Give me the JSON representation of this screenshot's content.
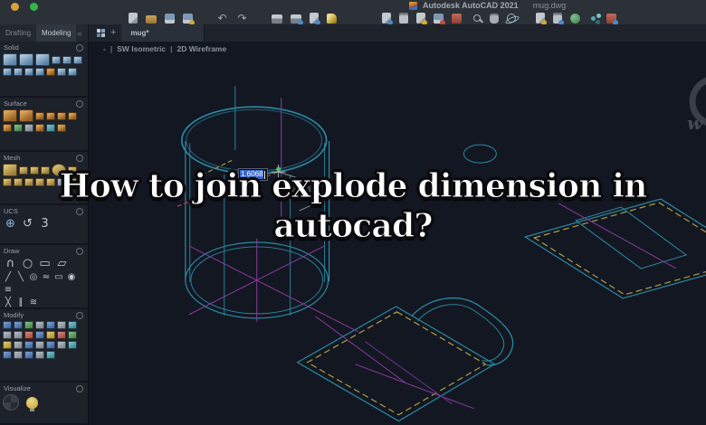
{
  "window": {
    "app_title": "Autodesk AutoCAD 2021",
    "doc_title": "mug.dwg",
    "traffic_lights": [
      "#d9a13c",
      "#34b54a"
    ]
  },
  "toolbar": {
    "groups": [
      [
        {
          "n": "new-file-icon",
          "c": "ic-doc"
        },
        {
          "n": "open-folder-icon",
          "c": "ic-folder"
        },
        {
          "n": "save-icon",
          "c": "ic-save"
        },
        {
          "n": "save-as-icon",
          "c": "ic-save acc-yellow"
        }
      ],
      [
        {
          "n": "undo-icon",
          "c": "ic-glyph",
          "g": "↶"
        },
        {
          "n": "redo-icon",
          "c": "ic-glyph",
          "g": "↷"
        }
      ],
      [
        {
          "n": "print-icon",
          "c": "ic-printer"
        },
        {
          "n": "print-preview-icon",
          "c": "ic-printer acc-blue"
        },
        {
          "n": "publish-icon",
          "c": "ic-doc acc-blue"
        },
        {
          "n": "page-setup-icon",
          "c": "ic-pencil"
        }
      ],
      [
        {
          "n": "copy-doc-icon",
          "c": "ic-doc acc-blue"
        },
        {
          "n": "paste-clipboard-icon",
          "c": "ic-clip"
        },
        {
          "n": "match-properties-icon",
          "c": "ic-doc acc-yellow"
        },
        {
          "n": "block-icon",
          "c": "ic-save acc-red"
        },
        {
          "n": "xref-book-icon",
          "c": "ic-book"
        }
      ],
      [
        {
          "n": "zoom-icon",
          "c": "ic-mag"
        },
        {
          "n": "pan-hand-icon",
          "c": "ic-hand"
        },
        {
          "n": "orbit-icon",
          "c": "ic-orbit"
        }
      ],
      [
        {
          "n": "markup-doc-icon",
          "c": "ic-doc acc-yellow"
        },
        {
          "n": "clipboard-chart-icon",
          "c": "ic-clip acc-blue"
        },
        {
          "n": "geolocation-globe-icon",
          "c": "ic-globe"
        },
        {
          "n": "nodes-icon",
          "c": "ic-node"
        },
        {
          "n": "reference-doc-icon",
          "c": "ic-book acc-blue"
        }
      ]
    ]
  },
  "palette": {
    "tabs": [
      {
        "label": "Drafting",
        "active": false
      },
      {
        "label": "Modeling",
        "active": true
      }
    ],
    "collapse": "«",
    "sections": [
      {
        "label": "Solid",
        "rows": [
          [
            {
              "n": "box-icon",
              "c": "tb f-solid"
            },
            {
              "n": "wedge-icon",
              "c": "tb f-solid"
            },
            {
              "n": "union-icon",
              "c": "tb f-solid"
            },
            {
              "n": "cylinder-icon",
              "c": "ts f-solid"
            },
            {
              "n": "sphere-icon",
              "c": "ts f-solid"
            },
            {
              "n": "cone-icon",
              "c": "ts f-solid"
            }
          ],
          [
            {
              "n": "extrude-icon",
              "c": "ts f-solid"
            },
            {
              "n": "revolve-icon",
              "c": "ts f-solid"
            },
            {
              "n": "sweep-icon",
              "c": "ts f-solid"
            },
            {
              "n": "loft-icon",
              "c": "ts f-solid"
            },
            {
              "n": "presspull-icon",
              "c": "ts f-surface"
            },
            {
              "n": "slice-icon",
              "c": "ts f-solid"
            },
            {
              "n": "shell-icon",
              "c": "ts f-solid"
            }
          ]
        ]
      },
      {
        "label": "Surface",
        "rows": [
          [
            {
              "n": "network-surface-icon",
              "c": "tb f-surface"
            },
            {
              "n": "loft-surface-icon",
              "c": "tb f-surface"
            },
            {
              "n": "blend-surface-icon",
              "c": "ts f-surface"
            },
            {
              "n": "patch-surface-icon",
              "c": "ts f-surface"
            },
            {
              "n": "offset-surface-icon",
              "c": "ts f-surface"
            },
            {
              "n": "fillet-surface-icon",
              "c": "ts f-surface"
            }
          ],
          [
            {
              "n": "trim-surface-icon",
              "c": "ts f-surface"
            },
            {
              "n": "untrim-surface-icon",
              "c": "ts f-green"
            },
            {
              "n": "extend-surface-icon",
              "c": "ts f-gray"
            },
            {
              "n": "sculpt-icon",
              "c": "ts f-surface"
            },
            {
              "n": "convert-surface-icon",
              "c": "ts f-teal"
            },
            {
              "n": "thicken-icon",
              "c": "ts f-surface"
            }
          ]
        ]
      },
      {
        "label": "Mesh",
        "rows": [
          [
            {
              "n": "mesh-box-icon",
              "c": "tb f-mesh"
            },
            {
              "n": "smooth-object-icon",
              "c": "ts f-mesh"
            },
            {
              "n": "refine-mesh-icon",
              "c": "ts f-mesh"
            },
            {
              "n": "add-crease-icon",
              "c": "ts f-mesh"
            },
            {
              "n": "mesh-sphere-icon",
              "c": "tb f-mesh round"
            },
            {
              "n": "split-face-icon",
              "c": "ts f-mesh"
            }
          ],
          [
            {
              "n": "mesh-cone-icon",
              "c": "ts f-mesh"
            },
            {
              "n": "mesh-cylinder-icon",
              "c": "ts f-mesh"
            },
            {
              "n": "mesh-pyramid-icon",
              "c": "ts f-mesh"
            },
            {
              "n": "mesh-wedge-icon",
              "c": "ts f-mesh"
            },
            {
              "n": "mesh-torus-icon",
              "c": "ts f-mesh"
            },
            {
              "n": "extrude-face-icon",
              "c": "ts f-gray"
            },
            {
              "n": "merge-face-icon",
              "c": "ts f-mesh"
            }
          ]
        ]
      },
      {
        "label": "UCS",
        "rows": [
          [
            {
              "n": "ucs-world-icon",
              "c": "g-draw g-big ucsw",
              "g": "⊕"
            },
            {
              "n": "ucs-rotate-z-icon",
              "c": "g-draw g-big",
              "g": "↺"
            },
            {
              "n": "ucs-3point-icon",
              "c": "g-draw g-big",
              "g": "3"
            }
          ]
        ]
      },
      {
        "label": "Draw",
        "rows": [
          [
            {
              "n": "arc-icon",
              "c": "g-draw g-big",
              "g": "∩"
            },
            {
              "n": "circle-icon",
              "c": "g-draw g-big",
              "g": "○"
            },
            {
              "n": "rectangle-icon",
              "c": "g-draw g-big",
              "g": "▭"
            },
            {
              "n": "plane-surface-icon",
              "c": "g-draw g-big",
              "g": "▱"
            }
          ],
          [
            {
              "n": "sketch-icon",
              "c": "g-draw",
              "g": "╱"
            },
            {
              "n": "line-icon",
              "c": "g-draw",
              "g": "╲"
            },
            {
              "n": "ellipse-icon",
              "c": "g-draw",
              "g": "◎"
            },
            {
              "n": "spline-icon",
              "c": "g-draw",
              "g": "≈"
            },
            {
              "n": "rectangle-small-icon",
              "c": "g-draw",
              "g": "▭"
            },
            {
              "n": "donut-icon",
              "c": "g-draw",
              "g": "◉"
            },
            {
              "n": "hatch-icon",
              "c": "g-draw",
              "g": "≡"
            }
          ],
          [
            {
              "n": "divide-icon",
              "c": "g-draw",
              "g": "╳"
            },
            {
              "n": "offset-lines-icon",
              "c": "g-draw",
              "g": "∥"
            },
            {
              "n": "revision-cloud-icon",
              "c": "g-draw",
              "g": "≋"
            }
          ]
        ]
      },
      {
        "label": "Modify",
        "rows": [
          [
            {
              "n": "move-icon",
              "c": "ts f-blue"
            },
            {
              "n": "copy-icon",
              "c": "ts f-blue"
            },
            {
              "n": "rotate-icon",
              "c": "ts f-green"
            },
            {
              "n": "mirror-icon",
              "c": "ts f-gray"
            },
            {
              "n": "array-icon",
              "c": "ts f-blue"
            },
            {
              "n": "scale-icon",
              "c": "ts f-gray"
            },
            {
              "n": "stretch-icon",
              "c": "ts f-teal"
            }
          ],
          [
            {
              "n": "fillet-icon",
              "c": "ts f-gray"
            },
            {
              "n": "chamfer-icon",
              "c": "ts f-gray"
            },
            {
              "n": "trim-icon",
              "c": "ts f-red"
            },
            {
              "n": "extend-icon",
              "c": "ts f-blue"
            },
            {
              "n": "offset-icon",
              "c": "ts f-yellow"
            },
            {
              "n": "erase-icon",
              "c": "ts f-red"
            },
            {
              "n": "join-icon",
              "c": "ts f-green"
            }
          ],
          [
            {
              "n": "explode-icon",
              "c": "ts f-yellow"
            },
            {
              "n": "break-icon",
              "c": "ts f-gray"
            },
            {
              "n": "lengthen-icon",
              "c": "ts f-blue"
            },
            {
              "n": "align-icon",
              "c": "ts f-gray"
            },
            {
              "n": "pedit-icon",
              "c": "ts f-blue"
            },
            {
              "n": "hatch-edit-icon",
              "c": "ts f-gray"
            },
            {
              "n": "measure-icon",
              "c": "ts f-teal"
            }
          ],
          [
            {
              "n": "group-icon",
              "c": "ts f-blue"
            },
            {
              "n": "block-edit-icon",
              "c": "ts f-gray"
            },
            {
              "n": "array-edit-icon",
              "c": "ts f-blue"
            },
            {
              "n": "overkill-icon",
              "c": "ts f-gray"
            },
            {
              "n": "set-bylayer-icon",
              "c": "ts f-teal"
            }
          ]
        ]
      },
      {
        "label": "Visualize",
        "rows": [
          [
            {
              "n": "render-icon",
              "c": "ic-render"
            },
            {
              "n": "lights-bulb-icon",
              "c": "ic-bulb"
            }
          ]
        ]
      }
    ]
  },
  "filetabs": {
    "new_tab": "+",
    "active_tab": "mug*"
  },
  "viewport": {
    "controls": "-",
    "separator": "|",
    "view": "SW Isometric",
    "style": "2D Wireframe"
  },
  "drawing": {
    "dimension_value": "1.6068",
    "colors": {
      "teal": "#2b89a2",
      "yellow_dash": "#ac9e44",
      "magenta": "#8a3a9c",
      "purple": "#6f3b8c",
      "purple_dark": "#5f2f80",
      "red_axis": "#a04040",
      "olive_axis": "#8f8f3f",
      "green_marker": "#49c25c",
      "selection_blue": "#3a66c9"
    }
  },
  "headline": {
    "line1": "How to join explode dimension in",
    "line2": "autocad?"
  },
  "watermark": {
    "letter": "w"
  }
}
